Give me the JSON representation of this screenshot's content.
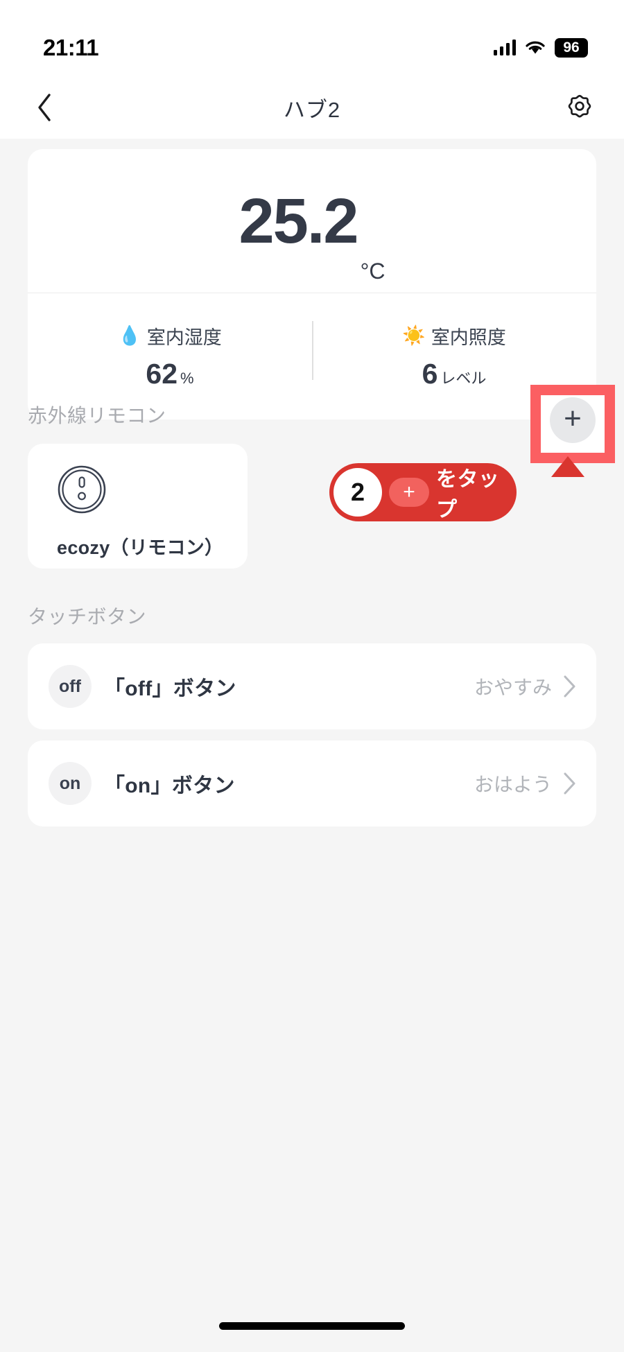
{
  "status_bar": {
    "time": "21:11",
    "battery": "96",
    "signal_icon": "cellular-bars-icon",
    "wifi_icon": "wifi-icon"
  },
  "nav": {
    "back_icon": "chevron-left-icon",
    "title": "ハブ2",
    "settings_icon": "gear-icon"
  },
  "sensor_card": {
    "temperature": "25.2",
    "temperature_unit": "°C",
    "metrics": [
      {
        "emoji": "💧",
        "icon_name": "humidity-droplet-icon",
        "label": "室内湿度",
        "value": "62",
        "unit": "%"
      },
      {
        "emoji": "☀️",
        "icon_name": "illuminance-sun-icon",
        "label": "室内照度",
        "value": "6",
        "unit": "レベル"
      }
    ]
  },
  "ir_section": {
    "title": "赤外線リモコン",
    "add_button": {
      "icon_name": "plus-icon",
      "glyph": "+",
      "highlight_color": "#fb5f62"
    },
    "devices": [
      {
        "icon_name": "ir-remote-device-icon",
        "name": "ecozy（リモコン）"
      }
    ]
  },
  "tooltip": {
    "step": "2",
    "plus_glyph": "+",
    "text": "をタップ",
    "bubble_color": "#d9352f",
    "plus_chip_color": "#f2625e"
  },
  "touch_section": {
    "title": "タッチボタン",
    "rows": [
      {
        "badge": "off",
        "label": "「off」ボタン",
        "value": "おやすみ",
        "chevron_icon": "chevron-right-icon"
      },
      {
        "badge": "on",
        "label": "「on」ボタン",
        "value": "おはよう",
        "chevron_icon": "chevron-right-icon"
      }
    ]
  },
  "home_indicator": {
    "icon_name": "home-indicator-bar"
  }
}
